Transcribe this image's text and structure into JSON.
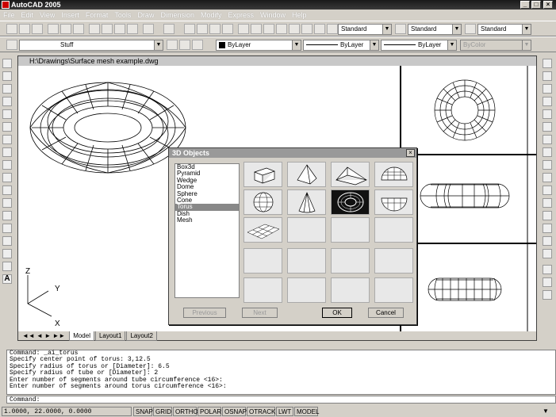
{
  "app": {
    "title": "AutoCAD 2005"
  },
  "menu": [
    "File",
    "Edit",
    "View",
    "Insert",
    "Format",
    "Tools",
    "Draw",
    "Dimension",
    "Modify",
    "Express",
    "Window",
    "Help"
  ],
  "toolbar": {
    "text_style": "Standard",
    "dim_style": "Standard",
    "table_style": "Standard",
    "layer": "Stuff",
    "color": "ByLayer",
    "linetype": "ByLayer",
    "lineweight": "ByLayer",
    "plotstyle": "ByColor"
  },
  "drawing": {
    "title": "H:\\Drawings\\Surface mesh example.dwg"
  },
  "ucs": {
    "z": "Z",
    "y": "Y",
    "x": "X"
  },
  "layout_tabs": [
    "Model",
    "Layout1",
    "Layout2"
  ],
  "dialog": {
    "title": "3D Objects",
    "items": [
      "Box3d",
      "Pyramid",
      "Wedge",
      "Dome",
      "Sphere",
      "Cone",
      "Torus",
      "Dish",
      "Mesh"
    ],
    "selected": "Torus",
    "previous_label": "Previous",
    "next_label": "Next",
    "ok_label": "OK",
    "cancel_label": "Cancel"
  },
  "command": {
    "lines": [
      "Command: _ai_torus",
      "Specify center point of torus: 3,12.5",
      "Specify radius of torus or [Diameter]: 6.5",
      "Specify radius of tube or [Diameter]: 2",
      "Enter number of segments around tube circumference <16>:",
      "Enter number of segments around torus circumference <16>:"
    ],
    "prompt": "Command:"
  },
  "status": {
    "coords": "1.0000, 22.0000, 0.0000",
    "buttons": [
      "SNAP",
      "GRID",
      "ORTHO",
      "POLAR",
      "OSNAP",
      "OTRACK",
      "LWT",
      "MODEL"
    ]
  }
}
